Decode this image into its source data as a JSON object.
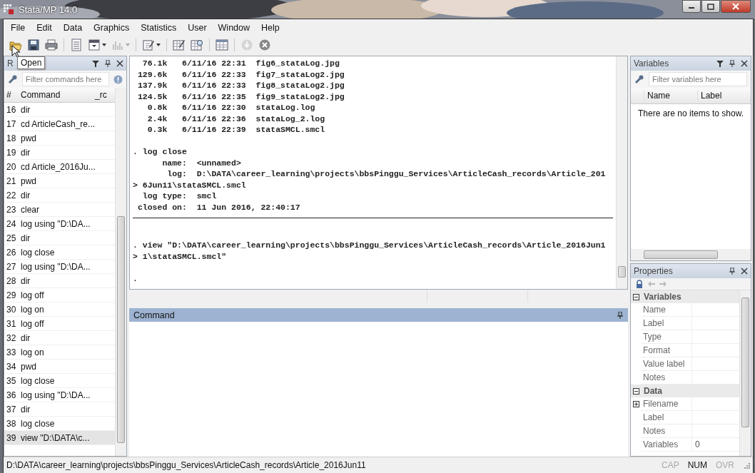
{
  "window": {
    "title": "Stata/MP 14.0"
  },
  "menu": [
    "File",
    "Edit",
    "Data",
    "Graphics",
    "Statistics",
    "User",
    "Window",
    "Help"
  ],
  "toolbar": [
    {
      "kind": "open",
      "disabled": false,
      "caret": false
    },
    {
      "kind": "save",
      "disabled": false,
      "caret": false
    },
    {
      "kind": "print",
      "disabled": false,
      "caret": false
    },
    {
      "kind": "sep"
    },
    {
      "kind": "log",
      "disabled": false,
      "caret": false
    },
    {
      "kind": "viewer",
      "disabled": false,
      "caret": true
    },
    {
      "kind": "graph",
      "disabled": true,
      "caret": true
    },
    {
      "kind": "sep"
    },
    {
      "kind": "dofile",
      "disabled": false,
      "caret": true
    },
    {
      "kind": "sep"
    },
    {
      "kind": "editor",
      "disabled": false,
      "caret": false
    },
    {
      "kind": "browser",
      "disabled": false,
      "caret": false
    },
    {
      "kind": "sep"
    },
    {
      "kind": "manager",
      "disabled": false,
      "caret": false
    },
    {
      "kind": "sep"
    },
    {
      "kind": "more",
      "disabled": true,
      "caret": false
    },
    {
      "kind": "break",
      "disabled": false,
      "caret": false
    }
  ],
  "tooltip": "Open",
  "review": {
    "title": "R",
    "filter_placeholder": "Filter commands here",
    "columns": [
      "#",
      "Command",
      "_rc"
    ],
    "rows": [
      {
        "n": "16",
        "cmd": "dir",
        "selected": false
      },
      {
        "n": "17",
        "cmd": "cd ArticleCash_re...",
        "selected": false
      },
      {
        "n": "18",
        "cmd": "pwd",
        "selected": false
      },
      {
        "n": "19",
        "cmd": "dir",
        "selected": false
      },
      {
        "n": "20",
        "cmd": "cd Article_2016Ju...",
        "selected": false
      },
      {
        "n": "21",
        "cmd": "pwd",
        "selected": false
      },
      {
        "n": "22",
        "cmd": "dir",
        "selected": false
      },
      {
        "n": "23",
        "cmd": "clear",
        "selected": false
      },
      {
        "n": "24",
        "cmd": "log using \"D:\\DA...",
        "selected": false
      },
      {
        "n": "25",
        "cmd": "dir",
        "selected": false
      },
      {
        "n": "26",
        "cmd": "log close",
        "selected": false
      },
      {
        "n": "27",
        "cmd": "log using \"D:\\DA...",
        "selected": false
      },
      {
        "n": "28",
        "cmd": "dir",
        "selected": false
      },
      {
        "n": "29",
        "cmd": "log off",
        "selected": false
      },
      {
        "n": "30",
        "cmd": "log on",
        "selected": false
      },
      {
        "n": "31",
        "cmd": "log off",
        "selected": false
      },
      {
        "n": "32",
        "cmd": "dir",
        "selected": false
      },
      {
        "n": "33",
        "cmd": "log on",
        "selected": false
      },
      {
        "n": "34",
        "cmd": "pwd",
        "selected": false
      },
      {
        "n": "35",
        "cmd": "log close",
        "selected": false
      },
      {
        "n": "36",
        "cmd": "log using \"D:\\DA...",
        "selected": false
      },
      {
        "n": "37",
        "cmd": "dir",
        "selected": false
      },
      {
        "n": "38",
        "cmd": "log close",
        "selected": false
      },
      {
        "n": "39",
        "cmd": "view \"D:\\DATA\\c...",
        "selected": true
      }
    ]
  },
  "results": [
    {
      "kind": "text",
      "text": "  76.1k   6/11/16 22:31  fig6_stataLog.jpg"
    },
    {
      "kind": "text",
      "text": " 129.6k   6/11/16 22:33  fig7_stataLog2.jpg"
    },
    {
      "kind": "text",
      "text": " 137.9k   6/11/16 22:33  fig8_stataLog2.jpg"
    },
    {
      "kind": "text",
      "text": " 124.5k   6/11/16 22:35  fig9_stataLog2.jpg"
    },
    {
      "kind": "text",
      "text": "   0.8k   6/11/16 22:30  stataLog.log"
    },
    {
      "kind": "text",
      "text": "   2.4k   6/11/16 22:36  stataLog_2.log"
    },
    {
      "kind": "text",
      "text": "   0.3k   6/11/16 22:39  stataSMCL.smcl"
    },
    {
      "kind": "blank"
    },
    {
      "kind": "text",
      "text": ". log close"
    },
    {
      "kind": "text",
      "text": "      name:  <unnamed>"
    },
    {
      "kind": "text",
      "text": "       log:  D:\\DATA\\career_learning\\projects\\bbsPinggu_Services\\ArticleCash_records\\Article_201"
    },
    {
      "kind": "text",
      "text": "> 6Jun11\\stataSMCL.smcl"
    },
    {
      "kind": "text",
      "text": "  log type:  smcl"
    },
    {
      "kind": "text",
      "text": " closed on:  11 Jun 2016, 22:40:17"
    },
    {
      "kind": "rule"
    },
    {
      "kind": "blank"
    },
    {
      "kind": "text",
      "text": ". view \"D:\\DATA\\career_learning\\projects\\bbsPinggu_Services\\ArticleCash_records\\Article_2016Jun1"
    },
    {
      "kind": "text",
      "text": "> 1\\stataSMCL.smcl\""
    },
    {
      "kind": "blank"
    },
    {
      "kind": "text",
      "text": "."
    }
  ],
  "command": {
    "title": "Command"
  },
  "variables": {
    "title": "Variables",
    "filter_placeholder": "Filter variables here",
    "columns": [
      "Name",
      "Label"
    ],
    "empty": "There are no items to show."
  },
  "properties": {
    "title": "Properties",
    "sections": [
      {
        "title": "Variables",
        "expanded": true,
        "rows": [
          {
            "label": "Name"
          },
          {
            "label": "Label"
          },
          {
            "label": "Type"
          },
          {
            "label": "Format"
          },
          {
            "label": "Value label"
          },
          {
            "label": "Notes"
          }
        ]
      },
      {
        "title": "Data",
        "expanded": true,
        "rows": [
          {
            "label": "Filename",
            "expandable": true
          },
          {
            "label": "Label"
          },
          {
            "label": "Notes"
          },
          {
            "label": "Variables",
            "value": "0"
          }
        ]
      }
    ]
  },
  "status_bar": {
    "path": "D:\\DATA\\career_learning\\projects\\bbsPinggu_Services\\ArticleCash_records\\Article_2016Jun11",
    "indicators": [
      {
        "label": "CAP",
        "on": false
      },
      {
        "label": "NUM",
        "on": true
      },
      {
        "label": "OVR",
        "on": false
      }
    ]
  }
}
